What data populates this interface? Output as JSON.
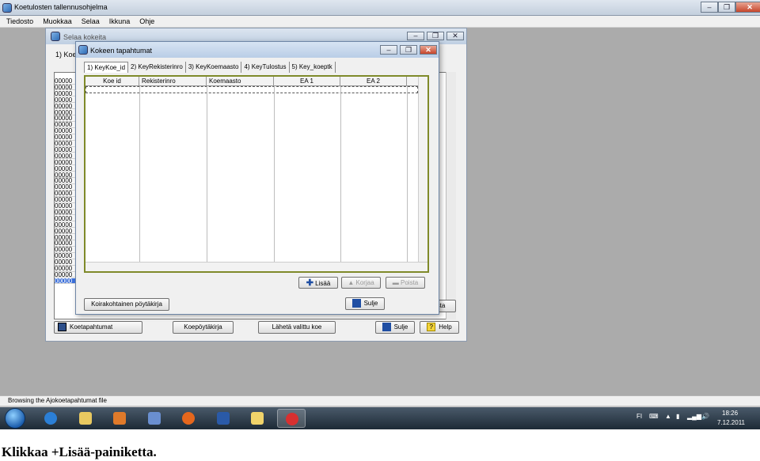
{
  "app": {
    "title": "Koetulosten tallennusohjelma",
    "menu": [
      "Tiedosto",
      "Muokkaa",
      "Selaa",
      "Ikkuna",
      "Ohje"
    ],
    "status": "Browsing the Ajokoetapahtumat file"
  },
  "selaa": {
    "title": "Selaa kokeita",
    "tab_fragment": "1) Koe",
    "rows": [
      "00000",
      "00000",
      "00000",
      "00000",
      "00000",
      "00000",
      "00000",
      "00000",
      "00000",
      "00000",
      "00000",
      "00000",
      "00000",
      "00000",
      "00000",
      "00000",
      "00000",
      "00000",
      "00000",
      "00000",
      "00000",
      "00000",
      "00000",
      "00000",
      "00000",
      "00000",
      "00000",
      "00000",
      "00000",
      "00000",
      "00000",
      "00000",
      "00000"
    ],
    "btn_koetapahtumat": "Koetapahtumat",
    "btn_koepoytakirja": "Koepöytäkirja",
    "btn_laheta": "Lähetä valittu koe",
    "btn_sulje": "Sulje",
    "btn_help": "Help",
    "btn_partial": "sta"
  },
  "kt": {
    "title": "Kokeen tapahtumat",
    "tabs": [
      "1) KeyKoe_id",
      "2) KeyRekisterinro",
      "3) KeyKoemaasto",
      "4) KeyTulostus",
      "5) Key_koeptk"
    ],
    "columns": [
      "Koe id",
      "Rekisterinro",
      "Koemaasto",
      "EA 1",
      "EA 2"
    ],
    "btn_lisaa": "Lisää",
    "btn_korjaa": "Korjaa",
    "btn_poista": "Poista",
    "btn_poytakirja": "Koirakohtainen pöytäkirja",
    "btn_sulje": "Sulje"
  },
  "tray": {
    "lang": "FI",
    "time": "18:26",
    "date": "7.12.2011"
  },
  "caption": "Klikkaa +Lisää-painiketta."
}
